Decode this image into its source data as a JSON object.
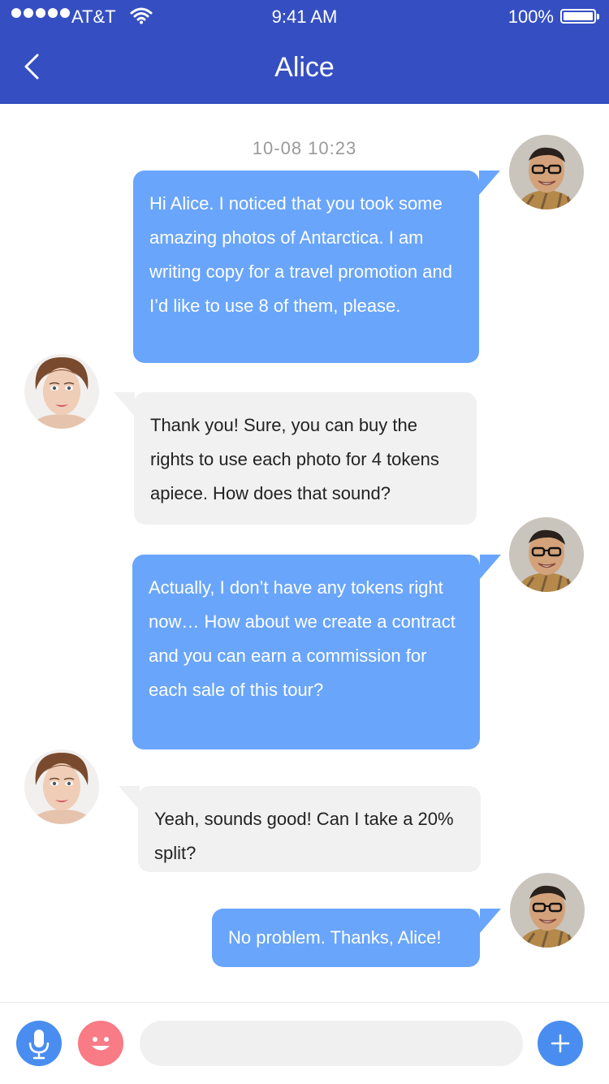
{
  "status_bar": {
    "carrier": "AT&T",
    "time": "9:41 AM",
    "battery": "100%"
  },
  "header": {
    "title": "Alice",
    "back_icon": "chevron-left-icon"
  },
  "conversation": {
    "timestamp": "10-08  10:23",
    "messages": [
      {
        "sender": "me",
        "text": "Hi Alice. I noticed that you took some amazing photos of Antarctica. I am writing copy for a travel promotion and I’d like to use 8 of them, please."
      },
      {
        "sender": "Alice",
        "text": "Thank you! Sure, you can buy the rights to use each photo for 4 tokens apiece. How does that sound?"
      },
      {
        "sender": "me",
        "text": "Actually, I don’t have any tokens right now… How about we create a contract and you can earn a commission for each sale of this tour?"
      },
      {
        "sender": "Alice",
        "text": "Yeah, sounds good! Can I take a 20% split?"
      },
      {
        "sender": "me",
        "text": "No problem. Thanks, Alice!"
      }
    ]
  },
  "input_bar": {
    "mic_icon": "microphone-icon",
    "emoji_icon": "smiley-icon",
    "message_value": "",
    "message_placeholder": "",
    "add_icon": "plus-icon"
  },
  "colors": {
    "header": "#354FC2",
    "outgoing_bubble": "#69A5FA",
    "incoming_bubble": "#F1F1F1",
    "accent": "#4A8DF0",
    "emoji_button": "#F87B85"
  }
}
